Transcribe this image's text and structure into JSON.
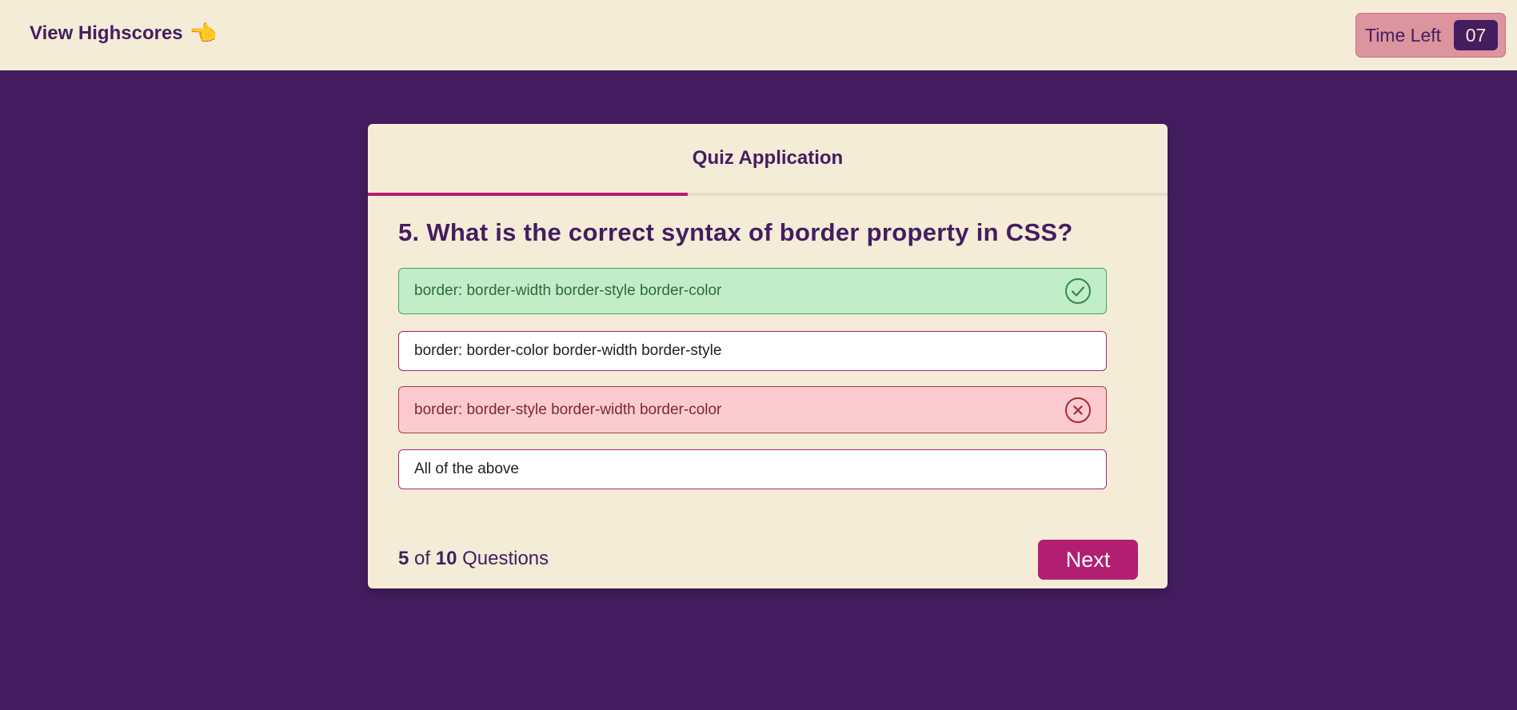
{
  "header": {
    "highscores_label": "View Highscores",
    "hand_icon": "👈",
    "timer_label": "Time Left",
    "timer_value": "07"
  },
  "quiz": {
    "title": "Quiz Application",
    "progress_fraction": 0.4,
    "question": "5. What is the correct syntax of border property in CSS?",
    "options": [
      {
        "text": "border: border-width border-style border-color",
        "state": "correct",
        "icon": "check-circle-icon"
      },
      {
        "text": "border: border-color border-width border-style",
        "state": "neutral"
      },
      {
        "text": "border: border-style border-width border-color",
        "state": "wrong",
        "icon": "x-circle-icon"
      },
      {
        "text": "All of the above",
        "state": "neutral"
      }
    ],
    "counter": {
      "current": "5",
      "of": "of",
      "total": "10",
      "suffix": "Questions"
    },
    "next_label": "Next"
  },
  "colors": {
    "background": "#441d60",
    "panel": "#f4ecd7",
    "accent": "#b21f72",
    "correct_bg": "#c1eec8",
    "wrong_bg": "#fbcbcf"
  }
}
